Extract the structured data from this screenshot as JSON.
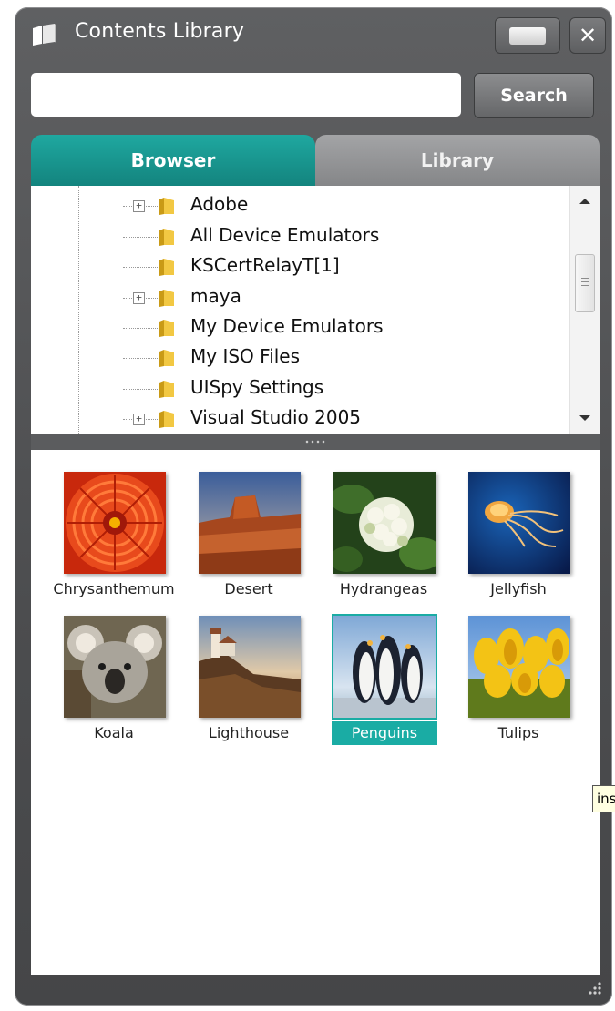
{
  "window": {
    "title": "Contents Library",
    "close_label": "✕"
  },
  "search": {
    "value": "",
    "placeholder": "",
    "button_label": "Search"
  },
  "tabs": [
    {
      "label": "Browser",
      "active": true
    },
    {
      "label": "Library",
      "active": false
    }
  ],
  "tree": {
    "items": [
      {
        "label": "Adobe",
        "expandable": true
      },
      {
        "label": "All Device Emulators",
        "expandable": false
      },
      {
        "label": "KSCertRelayT[1]",
        "expandable": false
      },
      {
        "label": "maya",
        "expandable": true
      },
      {
        "label": "My Device Emulators",
        "expandable": false
      },
      {
        "label": "My ISO Files",
        "expandable": false
      },
      {
        "label": "UISpy Settings",
        "expandable": false
      },
      {
        "label": "Visual Studio 2005",
        "expandable": true
      }
    ]
  },
  "thumbnails": [
    {
      "caption": "Chrysanthemum",
      "selected": false
    },
    {
      "caption": "Desert",
      "selected": false
    },
    {
      "caption": "Hydrangeas",
      "selected": false
    },
    {
      "caption": "Jellyfish",
      "selected": false
    },
    {
      "caption": "Koala",
      "selected": false
    },
    {
      "caption": "Lighthouse",
      "selected": false
    },
    {
      "caption": "Penguins",
      "selected": true
    },
    {
      "caption": "Tulips",
      "selected": false
    }
  ],
  "tooltip": {
    "text": "ins"
  },
  "colors": {
    "accent": "#1aaca4",
    "window_bg": "#4c4d4f",
    "tab_inactive": "#959698"
  }
}
